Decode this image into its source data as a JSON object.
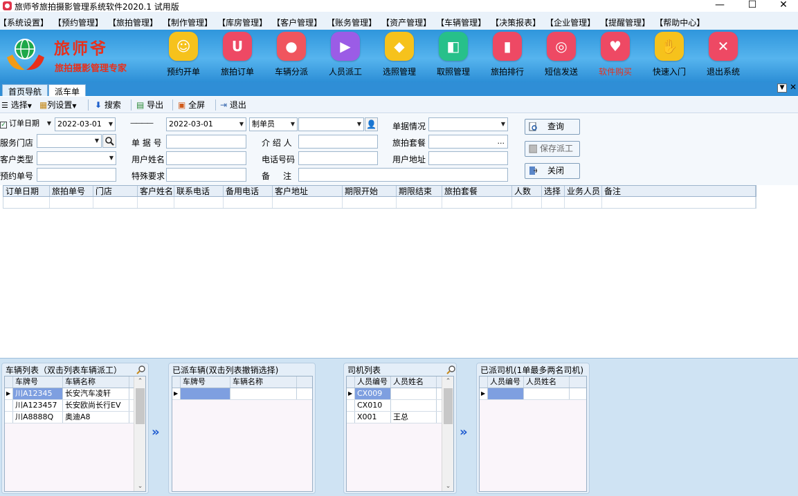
{
  "window": {
    "title": "旅师爷旅拍摄影管理系统软件2020.1 试用版",
    "minimize": "—",
    "maximize": "☐",
    "close": "✕"
  },
  "menu": [
    "【系统设置】",
    "【预约管理】",
    "【旅拍管理】",
    "【制作管理】",
    "【库房管理】",
    "【客户管理】",
    "【账务管理】",
    "【资产管理】",
    "【车辆管理】",
    "【决策报表】",
    "【企业管理】",
    "【提醒管理】",
    "【帮助中心】"
  ],
  "logo": {
    "name": "旅师爷",
    "slogan": "旅拍摄影管理专家"
  },
  "big_buttons": [
    {
      "label": "预约开单",
      "color": "#f6c21c",
      "icon": "calendar-icon",
      "glyph": "☺"
    },
    {
      "label": "旅拍订单",
      "color": "#ee4964",
      "icon": "order-icon",
      "glyph": "U"
    },
    {
      "label": "车辆分派",
      "color": "#f0555e",
      "icon": "balloon-icon",
      "glyph": "●"
    },
    {
      "label": "人员派工",
      "color": "#9b5ce6",
      "icon": "play-icon",
      "glyph": "▶"
    },
    {
      "label": "选照管理",
      "color": "#f6c21c",
      "icon": "diamond-icon",
      "glyph": "◆"
    },
    {
      "label": "取照管理",
      "color": "#27c08a",
      "icon": "package-icon",
      "glyph": "◧"
    },
    {
      "label": "旅拍排行",
      "color": "#ee4964",
      "icon": "bar-chart-icon",
      "glyph": "▮"
    },
    {
      "label": "短信发送",
      "color": "#ee4964",
      "icon": "signal-icon",
      "glyph": "◎"
    },
    {
      "label": "软件购买",
      "color": "#ee4964",
      "icon": "location-pin-icon",
      "glyph": "♥"
    },
    {
      "label": "快速入门",
      "color": "#f6c21c",
      "icon": "hand-icon",
      "glyph": "✋"
    },
    {
      "label": "退出系统",
      "color": "#ee4964",
      "icon": "exit-run-icon",
      "glyph": "✕"
    }
  ],
  "big_button_highlight": "#e8301b",
  "tabs": [
    "首页导航",
    "派车单"
  ],
  "toolbar": {
    "select": "选择",
    "columns": "列设置",
    "search": "搜索",
    "export": "导出",
    "fullscreen": "全屏",
    "exit": "退出"
  },
  "form": {
    "date_field": "订单日期",
    "date_from": "2022-03-01",
    "date_to": "2022-03-01",
    "date_dash": "————",
    "creator_field": "制单员",
    "creator_value": "",
    "doc_status_label": "单据情况",
    "doc_status_value": "",
    "store_label": "服务门店",
    "store_value": "",
    "doc_no_label": "单 据 号",
    "doc_no_value": "",
    "referrer_label": "介 绍 人",
    "referrer_value": "",
    "package_label": "旅拍套餐",
    "package_value": "...",
    "customer_type_label": "客户类型",
    "customer_type_value": "",
    "user_name_label": "用户姓名",
    "user_name_value": "",
    "phone_label": "电话号码",
    "phone_value": "",
    "address_label": "用户地址",
    "address_value": "",
    "booking_no_label": "预约单号",
    "booking_no_value": "",
    "special_label": "特殊要求",
    "special_value": "",
    "remark_label": "备     注",
    "remark_value": "",
    "query_btn": "查询",
    "save_btn": "保存派工",
    "close_btn": "关闭"
  },
  "grid": {
    "columns": [
      "订单日期",
      "旅拍单号",
      "门店",
      "客户姓名",
      "联系电话",
      "备用电话",
      "客户地址",
      "期限开始",
      "期限结束",
      "旅拍套餐",
      "人数",
      "选择",
      "业务人员",
      "备注"
    ]
  },
  "vehicle_list": {
    "title": "车辆列表（双击列表车辆派工）",
    "headers": [
      "车牌号",
      "车辆名称"
    ],
    "rows": [
      [
        "川A12345",
        "长安汽车凌轩"
      ],
      [
        "川A123457",
        "长安欧尚长行EV"
      ],
      [
        "川A8888Q",
        "奥迪A8"
      ]
    ]
  },
  "assigned_vehicles": {
    "title": "已派车辆(双击列表撤销选择)",
    "headers": [
      "车牌号",
      "车辆名称"
    ],
    "rows": [
      [
        "",
        ""
      ]
    ]
  },
  "driver_list": {
    "title": "司机列表",
    "headers": [
      "人员编号",
      "人员姓名"
    ],
    "rows": [
      [
        "CX009",
        ""
      ],
      [
        "CX010",
        ""
      ],
      [
        "X001",
        "王总"
      ]
    ]
  },
  "assigned_drivers": {
    "title": "已派司机(1单最多两名司机)",
    "headers": [
      "人员编号",
      "人员姓名"
    ],
    "rows": [
      [
        "",
        ""
      ]
    ]
  },
  "move_arrow": "»"
}
